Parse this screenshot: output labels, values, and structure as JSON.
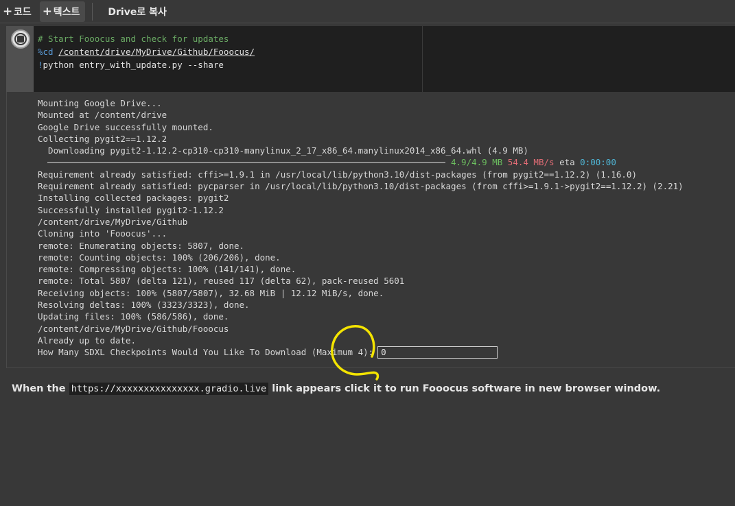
{
  "toolbar": {
    "add_code_label": "코드",
    "add_text_label": "텍스트",
    "copy_to_drive_label": "Drive로 복사"
  },
  "code_cell": {
    "comment": "# Start Fooocus and check for updates",
    "magic": "%cd",
    "cd_path": "/content/drive/MyDrive/Github/Fooocus/",
    "bang": "!",
    "command": "python entry_with_update.py --share"
  },
  "output": {
    "lines_before_progress": [
      "Mounting Google Drive...",
      "Mounted at /content/drive",
      "Google Drive successfully mounted.",
      "Collecting pygit2==1.12.2",
      "  Downloading pygit2-1.12.2-cp310-cp310-manylinux_2_17_x86_64.manylinux2014_x86_64.whl (4.9 MB)"
    ],
    "progress": {
      "fraction": 1.0,
      "done": "4.9/4.9 MB",
      "speed": "54.4 MB/s",
      "eta_label": "eta",
      "eta_value": "0:00:00"
    },
    "lines_after_progress": [
      "Requirement already satisfied: cffi>=1.9.1 in /usr/local/lib/python3.10/dist-packages (from pygit2==1.12.2) (1.16.0)",
      "Requirement already satisfied: pycparser in /usr/local/lib/python3.10/dist-packages (from cffi>=1.9.1->pygit2==1.12.2) (2.21)",
      "Installing collected packages: pygit2",
      "Successfully installed pygit2-1.12.2",
      "/content/drive/MyDrive/Github",
      "Cloning into 'Fooocus'...",
      "remote: Enumerating objects: 5807, done.",
      "remote: Counting objects: 100% (206/206), done.",
      "remote: Compressing objects: 100% (141/141), done.",
      "remote: Total 5807 (delta 121), reused 117 (delta 62), pack-reused 5601",
      "Receiving objects: 100% (5807/5807), 32.68 MiB | 12.12 MiB/s, done.",
      "Resolving deltas: 100% (3323/3323), done.",
      "Updating files: 100% (586/586), done.",
      "/content/drive/MyDrive/Github/Fooocus",
      "Already up to date."
    ],
    "prompt_text": "How Many SDXL Checkpoints Would You Like To Download (Maximum 4):",
    "prompt_value": "0"
  },
  "text_cell": {
    "before": "When the",
    "code": "https://xxxxxxxxxxxxxxx.gradio.live",
    "after": "link appears click it to run Fooocus software in new browser window."
  },
  "colors": {
    "background": "#383838",
    "editor_bg": "#1f1f1f",
    "comment": "#6aaa64",
    "magic": "#5a9ad6",
    "progress_done": "#6cbf5f",
    "progress_speed": "#e06c75",
    "progress_eta": "#4fb6d6",
    "annotation": "#f4e400"
  }
}
